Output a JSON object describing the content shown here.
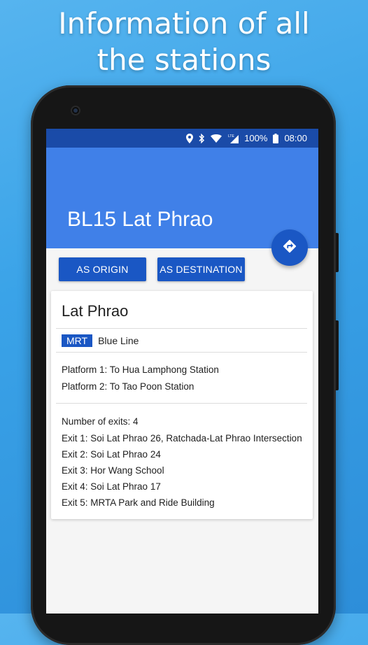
{
  "promo": {
    "line1": "Information of all",
    "line2": "the stations"
  },
  "status_bar": {
    "battery": "100%",
    "time": "08:00"
  },
  "app_bar": {
    "title": "BL15 Lat Phrao"
  },
  "actions": {
    "origin_label": "AS ORIGIN",
    "destination_label": "AS DESTINATION"
  },
  "station": {
    "name": "Lat Phrao",
    "operator_badge": "MRT",
    "line": "Blue Line",
    "platforms": [
      "Platform 1: To Hua Lamphong Station",
      "Platform 2: To Tao Poon Station"
    ],
    "exits_count": "Number of exits: 4",
    "exits": [
      "Exit 1: Soi Lat Phrao 26, Ratchada-Lat Phrao Intersection",
      "Exit 2: Soi Lat Phrao 24",
      "Exit 3: Hor Wang School",
      "Exit 4: Soi Lat Phrao 17",
      "Exit 5: MRTA Park and Ride Building"
    ]
  },
  "colors": {
    "background": "#3aa3e8",
    "status_bar": "#1a4ba8",
    "app_bar": "#4080e8",
    "accent": "#1a57c4"
  },
  "icons": [
    "location-icon",
    "bluetooth-icon",
    "wifi-icon",
    "lte-signal-icon",
    "battery-icon",
    "directions-icon"
  ]
}
